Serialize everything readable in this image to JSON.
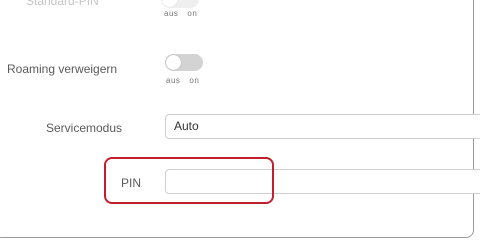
{
  "rows": {
    "top_partial": {
      "label": "Standard-PIN",
      "toggle": {
        "off_label": "aus",
        "on_label": "on",
        "state": "off"
      }
    },
    "roaming": {
      "label": "Roaming verweigern",
      "toggle": {
        "off_label": "aus",
        "on_label": "on",
        "state": "off"
      }
    },
    "service_mode": {
      "label": "Servicemodus",
      "value": "Auto"
    },
    "pin": {
      "label": "PIN",
      "value": "",
      "placeholder": ""
    }
  },
  "colors": {
    "highlight": "#c21f2e",
    "toggle_off": "#d3d3d3",
    "panel_border": "#9a9a9a"
  }
}
